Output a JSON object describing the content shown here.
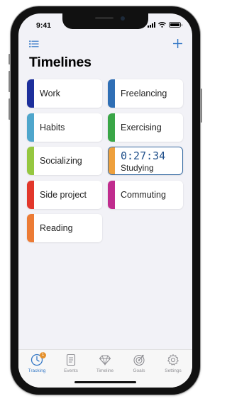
{
  "status_bar": {
    "time": "9:41"
  },
  "header": {
    "title": "Timelines"
  },
  "timelines": [
    {
      "label": "Work",
      "color": "#1d2f9c"
    },
    {
      "label": "Freelancing",
      "color": "#2f6fb5"
    },
    {
      "label": "Habits",
      "color": "#4fa6cc"
    },
    {
      "label": "Exercising",
      "color": "#3aa647"
    },
    {
      "label": "Socializing",
      "color": "#95c740"
    },
    {
      "label": "Studying",
      "color": "#eea03c",
      "timer": "0:27:34",
      "active": true
    },
    {
      "label": "Side project",
      "color": "#e2372b"
    },
    {
      "label": "Commuting",
      "color": "#c02c8e"
    },
    {
      "label": "Reading",
      "color": "#ec7b35"
    }
  ],
  "tab_bar": {
    "tabs": [
      {
        "label": "Tracking",
        "icon": "clock-icon",
        "selected": true,
        "badge": "1"
      },
      {
        "label": "Events",
        "icon": "document-icon"
      },
      {
        "label": "Timeline",
        "icon": "diamond-icon"
      },
      {
        "label": "Goals",
        "icon": "target-icon"
      },
      {
        "label": "Settings",
        "icon": "gear-icon"
      }
    ]
  },
  "colors": {
    "accent": "#3478c6",
    "timer_text": "#1f4f8a",
    "badge": "#e5912d",
    "background": "#f2f2f7"
  }
}
